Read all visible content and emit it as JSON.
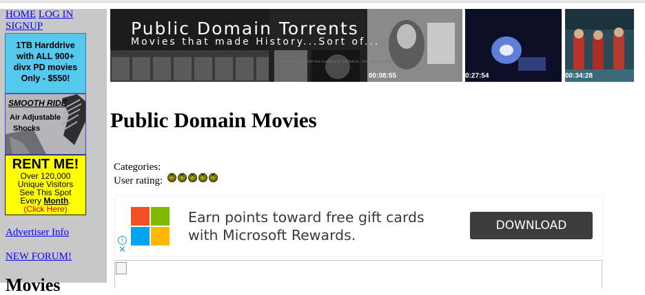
{
  "nav": {
    "home": "HOME",
    "login": "LOG IN",
    "signup": "SIGNUP"
  },
  "ads": {
    "hdd_lines": [
      "1TB Harddrive",
      "with ALL 900+",
      "divx PD movies",
      "Only - $550!"
    ],
    "shocks_title": "SMOOTH RIDE",
    "shocks_lines": [
      "Air Adjustable",
      "Shocks"
    ],
    "rent_title": "RENT ME!",
    "rent_lines": [
      "Over 120,000",
      "Unique Visitors",
      "See This Spot"
    ],
    "rent_every": "Every",
    "rent_month": "Month",
    "rent_click": "(Click Here)"
  },
  "sidebar": {
    "advertiser": "Advertiser Info",
    "forum": "NEW FORUM!",
    "heading_partial": "Movies"
  },
  "banner": {
    "title": "Public Domain Torrents",
    "subtitle": "Movies that made History...Sort of...",
    "timestamps": [
      "00:08:55",
      "0:27:54",
      "00:34:28"
    ],
    "small_text": "a hand in here created the numbers of the future - the machine own?"
  },
  "page": {
    "title": "Public Domain Movies",
    "categories_label": "Categories:",
    "rating_label": "User rating:",
    "rating_value": 5
  },
  "promo": {
    "line1": "Earn points toward free gift cards",
    "line2": "with Microsoft Rewards.",
    "button": "DOWNLOAD",
    "logo_colors": [
      "#f25022",
      "#7fba00",
      "#00a4ef",
      "#ffb900"
    ]
  }
}
